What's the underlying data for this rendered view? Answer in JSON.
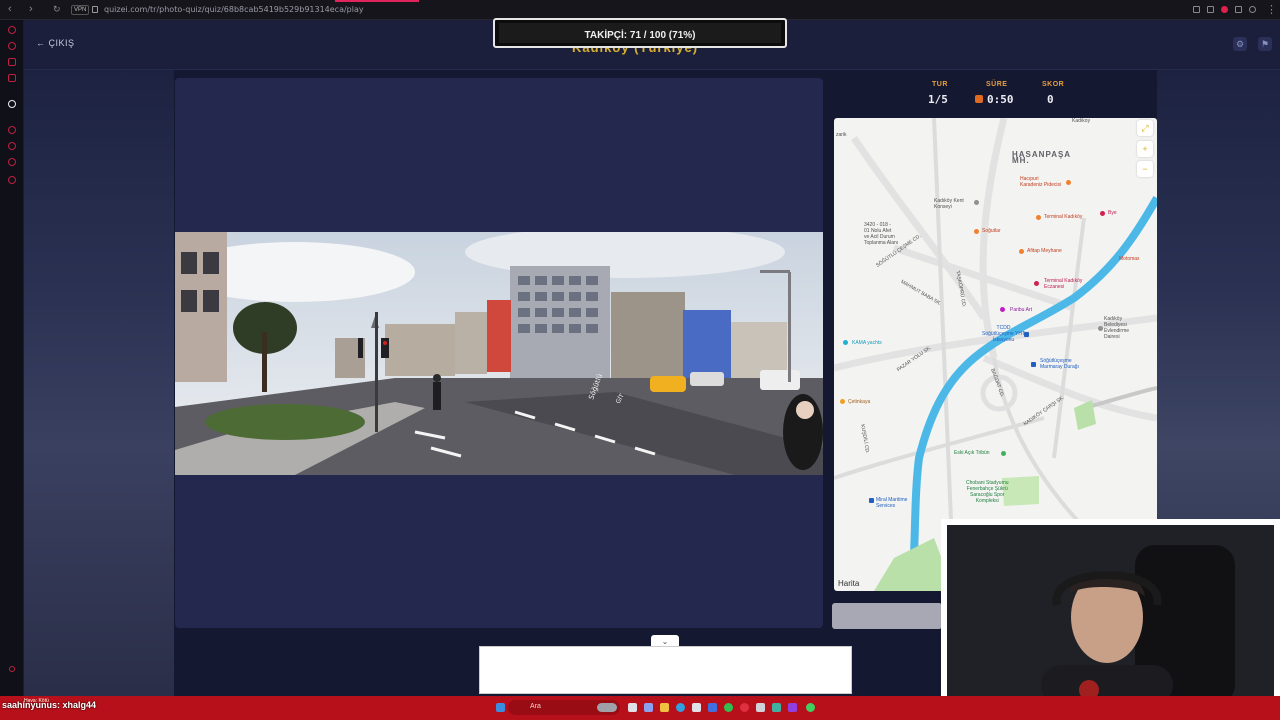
{
  "browser": {
    "vpn_label": "VPN",
    "url": "quizei.com/tr/photo-quiz/quiz/68b8cab5419b529b91314eca/play"
  },
  "header": {
    "exit_label": "ÇIKIŞ",
    "quiz_title_partial": "Kadıköy (Türkiye)"
  },
  "follower_goal": {
    "text": "TAKİPÇİ: 71 / 100 (71%)",
    "current": 71,
    "target": 100,
    "percent": 71
  },
  "stats": {
    "round_label": "TUR",
    "round_value": "1/5",
    "time_label": "SÜRE",
    "time_value": "0:50",
    "score_label": "SKOR",
    "score_value": "0"
  },
  "map": {
    "district_label": "HASANPAŞA\nMH.",
    "labels": {
      "kadikoy_top": "Kadıkoy",
      "hacipuri": "Hacıpuri\nKaradeniz Pidecisi",
      "terminal_kadikoy": "Terminal Kadıköy",
      "bye": "Bye",
      "kent_konseyi": "Kadıköy Kent\nKonseyi",
      "emergency": "3420 - 018 -\n01 Nolu Afet\nve Acil Durum\nToplanma Alanı",
      "sojutlar": "Soğutlar",
      "afitap": "Afitap Meyhane",
      "motomax": "Motomax",
      "terminal_eczane": "Terminal Kadıköy\nEczanesi",
      "paribu": "Paribu Art",
      "tcdd": "TCDD\nSöğütlüçeşme YHT\nİstasyonu",
      "kamayachts": "KAMA yachts",
      "belediye": "Kadıköy\nBelediyesi\nEvlendirme\nDairesi",
      "marmaray": "Söğütlüçeşme\nMarmaray Durağı",
      "cetinkaya": "Çetinkaya",
      "eski_acik": "Eski Açık Tribün",
      "stadium": "Chobani Stadyumu\nFenerbahçe Şükrü\nSaracoğlu Spor\nKompleksi",
      "maritime": "Miral Maritime\nServices",
      "zarik": "zarik",
      "street_sogutlucesme": "SÖĞÜTLÜ ÇEŞME CD.",
      "street_mahmut": "MAHMUT BABA SK.",
      "street_taskopru": "TAŞKÖPRÜ CD.",
      "street_pazar": "PAZAR YOLU SK.",
      "street_bagdat": "BAĞDAT CD.",
      "street_kadikoy": "KADIKÖY ÇARŞI SK.",
      "street_kusdili": "KUŞDİLİ CD."
    },
    "attribution": "Harita"
  },
  "street_signs": {
    "sign1": "Söğütlü",
    "sign2": "GİT"
  },
  "stream": {
    "chat_text": "saahinyunus: xhalg44",
    "weather": "Hava: Kötü"
  },
  "taskbar": {
    "search_placeholder": "Ara"
  },
  "colors": {
    "accent": "#d8b030",
    "stat_label": "#e8a040",
    "panel": "#25284e",
    "header": "#1b1f3c",
    "taskbar": "#b8101a"
  }
}
